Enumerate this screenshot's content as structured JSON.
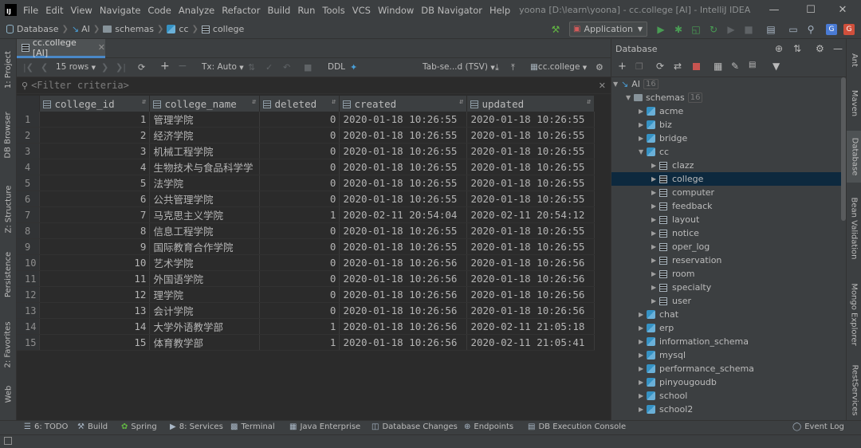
{
  "titlebar": {
    "menu": [
      "File",
      "Edit",
      "View",
      "Navigate",
      "Code",
      "Analyze",
      "Refactor",
      "Build",
      "Run",
      "Tools",
      "VCS",
      "Window",
      "DB Navigator",
      "Help"
    ],
    "window_title": "yoona [D:\\learn\\yoona] - cc.college [AI] - IntelliJ IDEA"
  },
  "navbar": {
    "breadcrumbs": [
      "Database",
      "AI",
      "schemas",
      "cc",
      "college"
    ],
    "run_config": "Application"
  },
  "left_stripe": [
    "1: Project",
    "DB Browser",
    "Z: Structure",
    "Persistence",
    "2: Favorites",
    "Web"
  ],
  "editor": {
    "tab_label": "cc.college [AI]",
    "rows_label": "15 rows",
    "tx_label": "Tx: Auto",
    "ddl_label": "DDL",
    "format_label": "Tab-se...d (TSV)",
    "target_label": "cc.college",
    "filter_placeholder": "<Filter criteria>"
  },
  "grid": {
    "columns": [
      "college_id",
      "college_name",
      "deleted",
      "created",
      "updated"
    ],
    "rows": [
      [
        "1",
        "1",
        "管理学院",
        "0",
        "2020-01-18 10:26:55",
        "2020-01-18 10:26:55"
      ],
      [
        "2",
        "2",
        "经济学院",
        "0",
        "2020-01-18 10:26:55",
        "2020-01-18 10:26:55"
      ],
      [
        "3",
        "3",
        "机械工程学院",
        "0",
        "2020-01-18 10:26:55",
        "2020-01-18 10:26:55"
      ],
      [
        "4",
        "4",
        "生物技术与食品科学学",
        "0",
        "2020-01-18 10:26:55",
        "2020-01-18 10:26:55"
      ],
      [
        "5",
        "5",
        "法学院",
        "0",
        "2020-01-18 10:26:55",
        "2020-01-18 10:26:55"
      ],
      [
        "6",
        "6",
        "公共管理学院",
        "0",
        "2020-01-18 10:26:55",
        "2020-01-18 10:26:55"
      ],
      [
        "7",
        "7",
        "马克思主义学院",
        "1",
        "2020-02-11 20:54:04",
        "2020-02-11 20:54:12"
      ],
      [
        "8",
        "8",
        "信息工程学院",
        "0",
        "2020-01-18 10:26:55",
        "2020-01-18 10:26:55"
      ],
      [
        "9",
        "9",
        "国际教育合作学院",
        "0",
        "2020-01-18 10:26:55",
        "2020-01-18 10:26:55"
      ],
      [
        "10",
        "10",
        "艺术学院",
        "0",
        "2020-01-18 10:26:56",
        "2020-01-18 10:26:56"
      ],
      [
        "11",
        "11",
        "外国语学院",
        "0",
        "2020-01-18 10:26:56",
        "2020-01-18 10:26:56"
      ],
      [
        "12",
        "12",
        "理学院",
        "0",
        "2020-01-18 10:26:56",
        "2020-01-18 10:26:56"
      ],
      [
        "13",
        "13",
        "会计学院",
        "0",
        "2020-01-18 10:26:56",
        "2020-01-18 10:26:56"
      ],
      [
        "14",
        "14",
        "大学外语教学部",
        "1",
        "2020-01-18 10:26:56",
        "2020-02-11 21:05:18"
      ],
      [
        "15",
        "15",
        "体育教学部",
        "1",
        "2020-01-18 10:26:56",
        "2020-02-11 21:05:41"
      ]
    ]
  },
  "db_panel": {
    "title": "Database",
    "tree": [
      {
        "label": "AI",
        "count": "16"
      },
      {
        "label": "schemas",
        "count": "16"
      },
      {
        "label": "acme"
      },
      {
        "label": "biz"
      },
      {
        "label": "bridge"
      },
      {
        "label": "cc"
      },
      {
        "label": "clazz"
      },
      {
        "label": "college"
      },
      {
        "label": "computer"
      },
      {
        "label": "feedback"
      },
      {
        "label": "layout"
      },
      {
        "label": "notice"
      },
      {
        "label": "oper_log"
      },
      {
        "label": "reservation"
      },
      {
        "label": "room"
      },
      {
        "label": "specialty"
      },
      {
        "label": "user"
      },
      {
        "label": "chat"
      },
      {
        "label": "erp"
      },
      {
        "label": "information_schema"
      },
      {
        "label": "mysql"
      },
      {
        "label": "performance_schema"
      },
      {
        "label": "pinyougoudb"
      },
      {
        "label": "school"
      },
      {
        "label": "school2"
      }
    ]
  },
  "right_stripe": [
    "Ant",
    "Maven",
    "Database",
    "Bean Validation",
    "Mongo Explorer",
    "RestServices"
  ],
  "bottom_bar": {
    "tabs": [
      "6: TODO",
      "Build",
      "Spring",
      "8: Services",
      "Terminal",
      "Java Enterprise",
      "Database Changes",
      "Endpoints",
      "DB Execution Console"
    ],
    "event_log": "Event Log"
  }
}
